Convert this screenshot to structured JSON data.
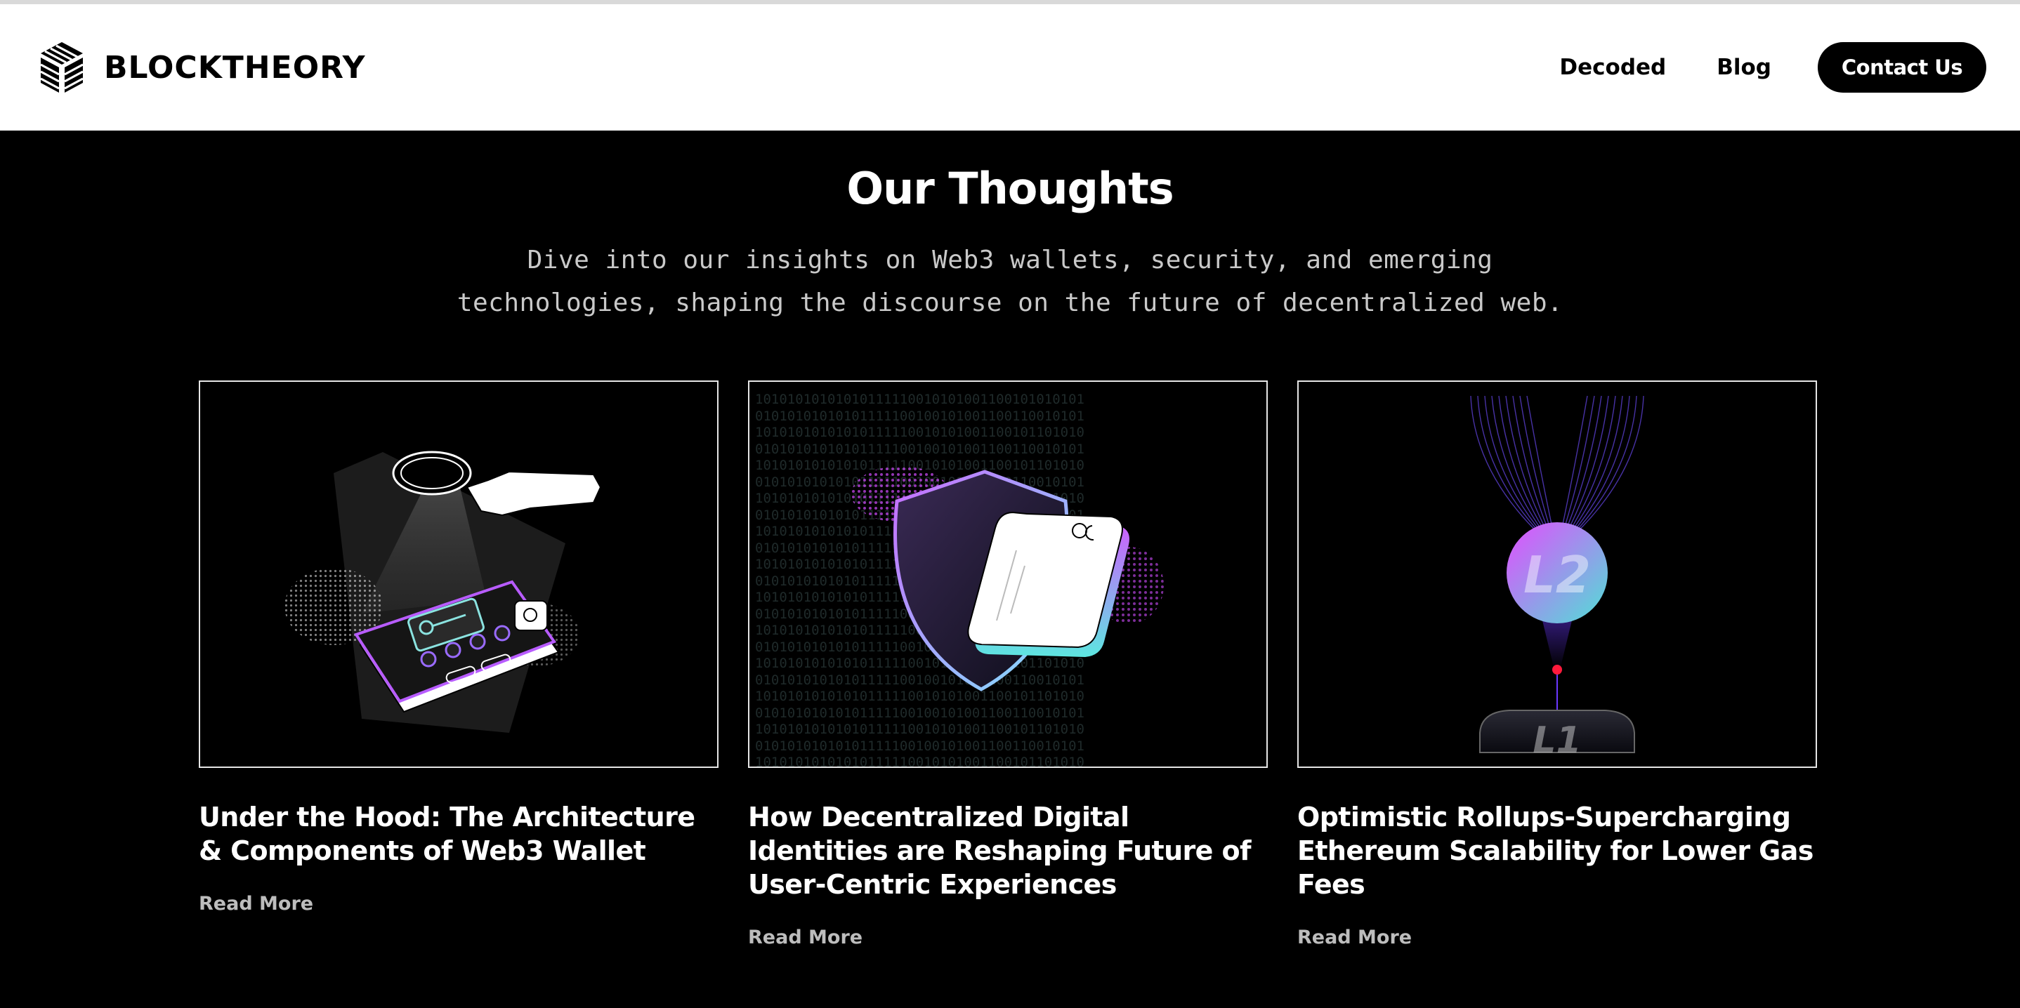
{
  "header": {
    "brand": "BLOCKTHEORY",
    "nav": {
      "decoded": "Decoded",
      "blog": "Blog",
      "contact": "Contact Us"
    }
  },
  "section": {
    "title": "Our Thoughts",
    "subtitle": "Dive into our insights on Web3 wallets, security, and emerging technologies, shaping the discourse on the future of decentralized web."
  },
  "cards": [
    {
      "title": "Under the Hood: The Architecture & Components of Web3 Wallet",
      "read_more": "Read More"
    },
    {
      "title": "How Decentralized Digital Identities are Reshaping Future of User-Centric Experiences",
      "read_more": "Read More"
    },
    {
      "title": "Optimistic Rollups-Supercharging Ethereum Scalability for Lower Gas Fees",
      "read_more": "Read More",
      "image_labels": {
        "top": "L2",
        "bottom": "L1"
      }
    }
  ],
  "colors": {
    "background": "#000000",
    "header_bg": "#ffffff",
    "accent_purple": "#b44cf0",
    "accent_teal": "#4fd6c8",
    "red_dot": "#ff1a3c"
  }
}
